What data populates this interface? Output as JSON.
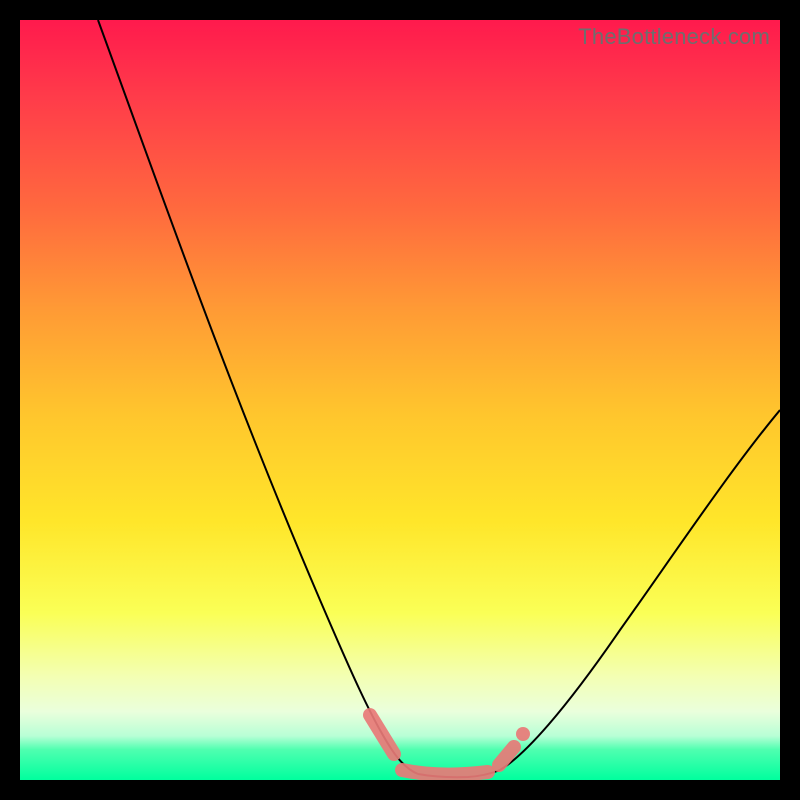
{
  "watermark": "TheBottleneck.com",
  "colors": {
    "top": "#ff1a4d",
    "mid": "#ffe62a",
    "bottom": "#00ff9e",
    "curve": "#000000",
    "highlight": "#e87a77",
    "background": "#000000"
  },
  "chart_data": {
    "type": "line",
    "title": "",
    "xlabel": "",
    "ylabel": "",
    "xlim": [
      0,
      100
    ],
    "ylim": [
      0,
      100
    ],
    "grid": false,
    "series": [
      {
        "name": "left-branch",
        "x": [
          10,
          15,
          20,
          25,
          30,
          35,
          40,
          44,
          47,
          50
        ],
        "y": [
          100,
          88,
          74,
          60,
          46,
          32,
          18,
          8,
          2,
          0
        ]
      },
      {
        "name": "valley-floor",
        "x": [
          50,
          53,
          56,
          60
        ],
        "y": [
          0,
          0,
          0,
          0
        ]
      },
      {
        "name": "right-branch",
        "x": [
          60,
          63,
          67,
          72,
          78,
          85,
          92,
          100
        ],
        "y": [
          0,
          2,
          7,
          14,
          23,
          34,
          45,
          55
        ]
      }
    ],
    "highlight_segments": [
      {
        "x": [
          44.5,
          47.5
        ],
        "y": [
          9,
          2
        ]
      },
      {
        "x": [
          48.5,
          60.0
        ],
        "y": [
          0.5,
          0.5
        ]
      },
      {
        "x": [
          61.5,
          63.5
        ],
        "y": [
          1.5,
          4
        ]
      }
    ],
    "highlight_dots": [
      {
        "x": 64.5,
        "y": 6
      }
    ]
  }
}
